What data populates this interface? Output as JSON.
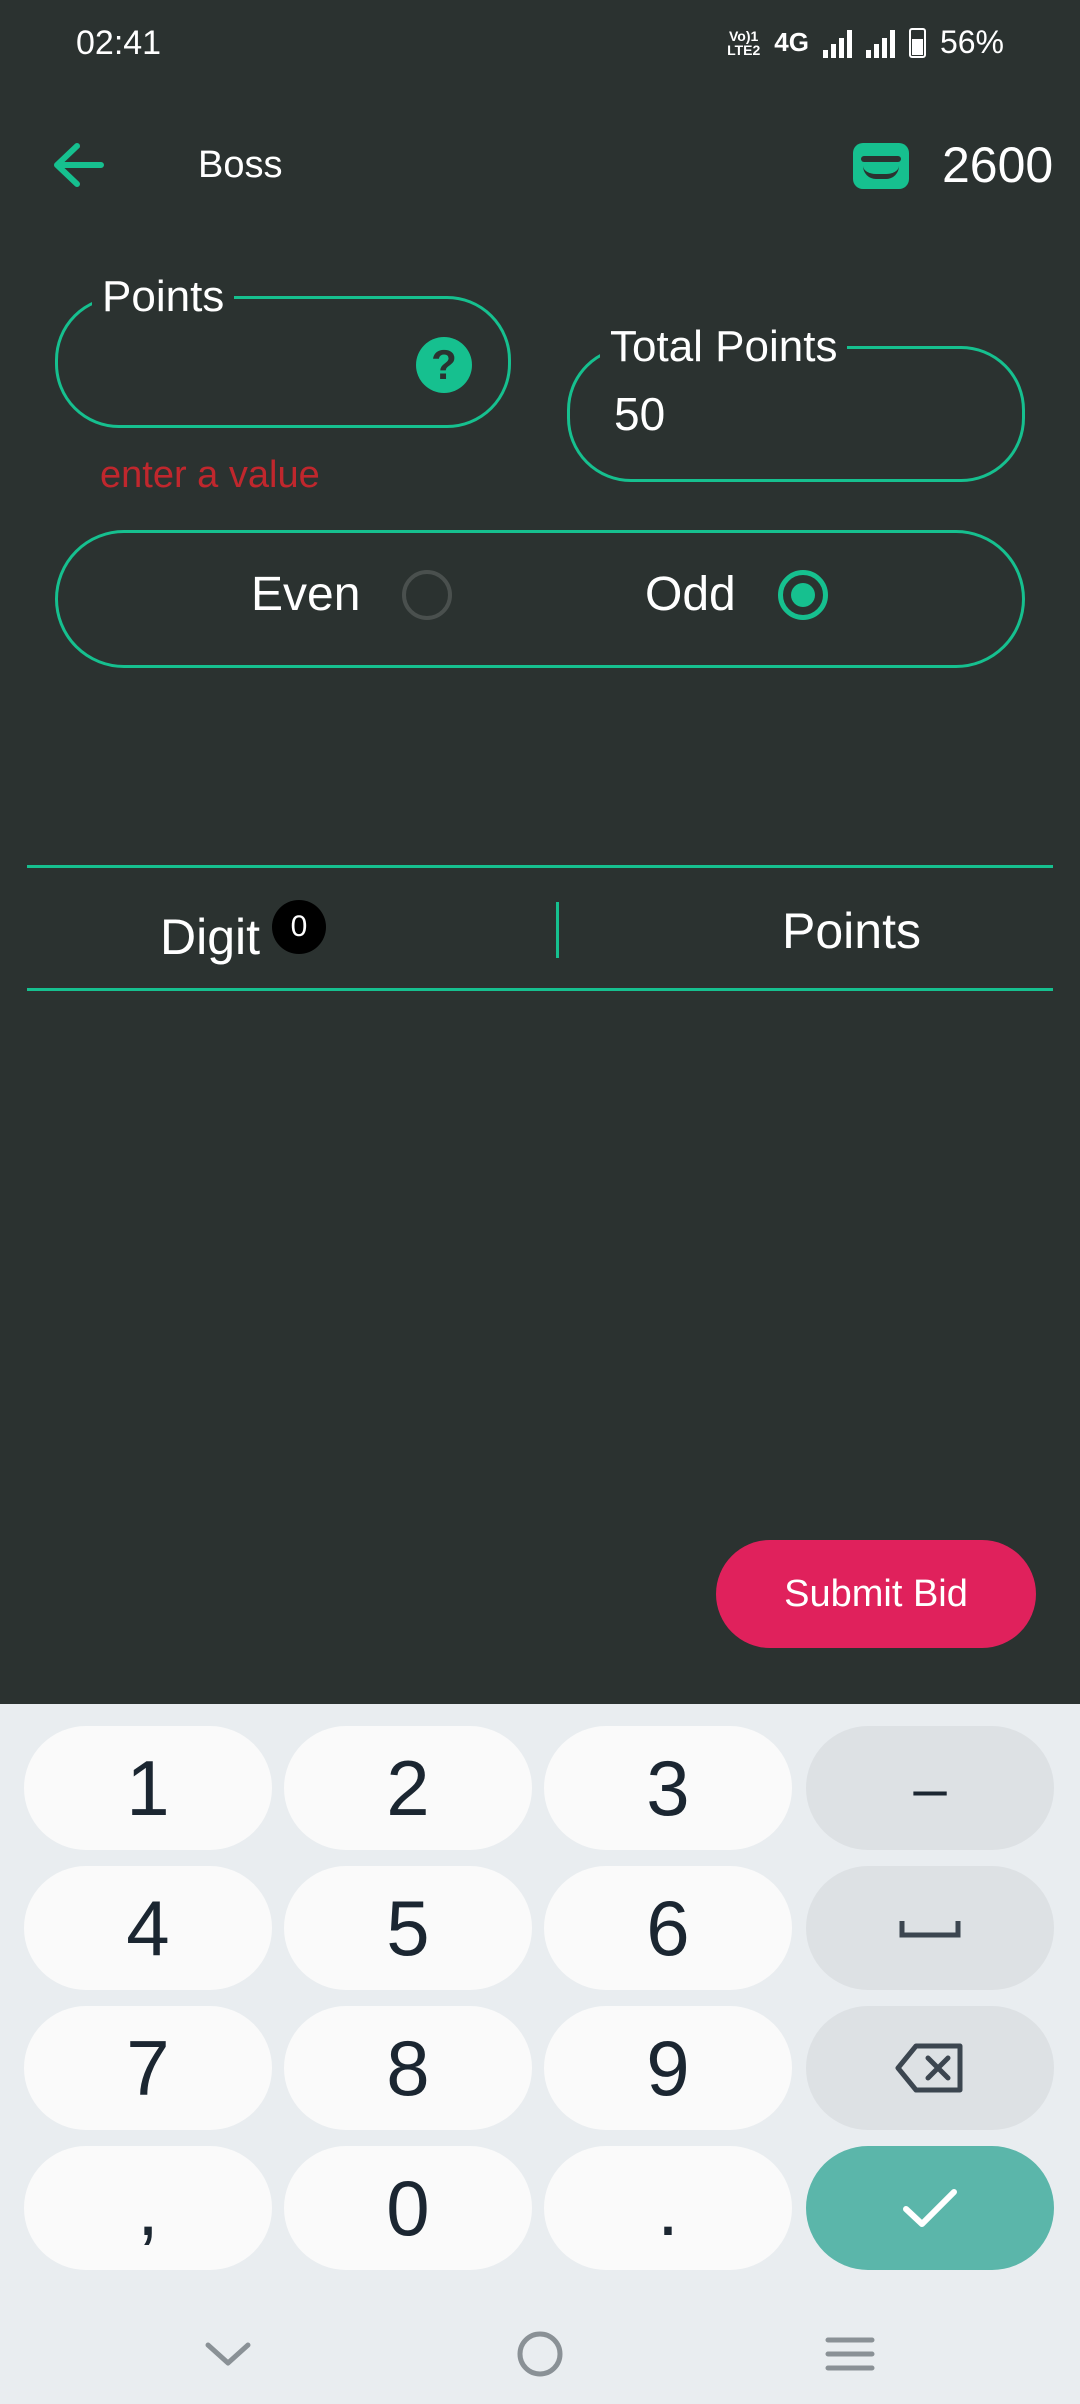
{
  "status_bar": {
    "time": "02:41",
    "network_small": "Vo) 1\nLTE2",
    "network_type": "4G",
    "battery": "56%"
  },
  "header": {
    "title": "Boss",
    "wallet_amount": "2600",
    "back_icon": "arrow-left-icon",
    "wallet_icon": "wallet-icon"
  },
  "points_field": {
    "label": "Points",
    "value": "",
    "error": "enter a value",
    "help_icon": "help-icon"
  },
  "total_points": {
    "label": "Total Points",
    "value": "50"
  },
  "bet_type": {
    "options": [
      "Even",
      "Odd"
    ],
    "selected": "Odd"
  },
  "table": {
    "col_digit": "Digit",
    "digit_count": "0",
    "col_points": "Points"
  },
  "submit": {
    "label": "Submit Bid"
  },
  "keyboard": {
    "rows": [
      [
        "1",
        "2",
        "3",
        "–"
      ],
      [
        "4",
        "5",
        "6",
        "space"
      ],
      [
        "7",
        "8",
        "9",
        "backspace"
      ],
      [
        ",",
        "0",
        ".",
        "enter"
      ]
    ]
  },
  "colors": {
    "accent": "#16c08f",
    "background": "#2b3230",
    "error": "#c0272d",
    "submit": "#e0215c",
    "enter_key": "#5bb6aa"
  }
}
